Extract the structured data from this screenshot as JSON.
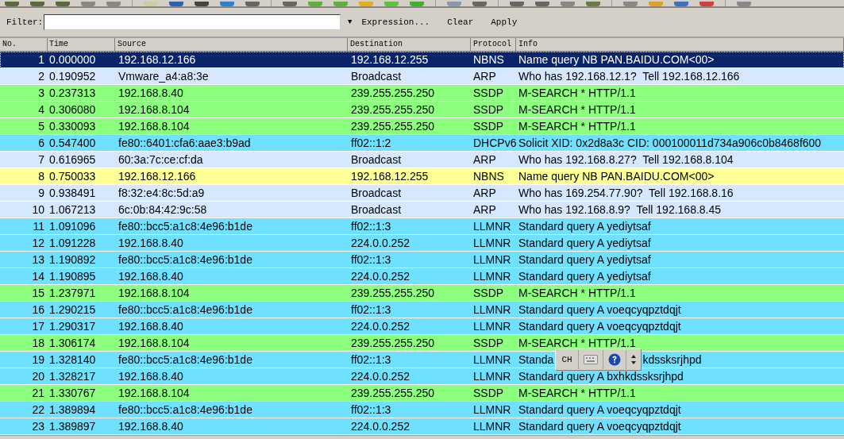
{
  "filter_bar": {
    "label": "Filter:",
    "dropdown": "▼",
    "buttons": [
      "Expression...",
      "Clear",
      "Apply"
    ]
  },
  "columns": [
    "No.",
    "Time",
    "Source",
    "Destination",
    "Protocol",
    "Info"
  ],
  "rows": [
    {
      "no": "1",
      "time": "0.000000",
      "source": "192.168.12.166",
      "destination": "192.168.12.255",
      "protocol": "NBNS",
      "info": "Name query NB PAN.BAIDU.COM<00>",
      "selected": true
    },
    {
      "no": "2",
      "time": "0.190952",
      "source": "Vmware_a4:a8:3e",
      "destination": "Broadcast",
      "protocol": "ARP",
      "info": "Who has 192.168.12.1?  Tell 192.168.12.166",
      "color": "#d6e8ff",
      "selected": false
    },
    {
      "no": "3",
      "time": "0.237313",
      "source": "192.168.8.40",
      "destination": "239.255.255.250",
      "protocol": "SSDP",
      "info": "M-SEARCH * HTTP/1.1",
      "color": "#8cff7f",
      "selected": false
    },
    {
      "no": "4",
      "time": "0.306080",
      "source": "192.168.8.104",
      "destination": "239.255.255.250",
      "protocol": "SSDP",
      "info": "M-SEARCH * HTTP/1.1",
      "color": "#8cff7f",
      "selected": false
    },
    {
      "no": "5",
      "time": "0.330093",
      "source": "192.168.8.104",
      "destination": "239.255.255.250",
      "protocol": "SSDP",
      "info": "M-SEARCH * HTTP/1.1",
      "color": "#8cff7f",
      "selected": false
    },
    {
      "no": "6",
      "time": "0.547400",
      "source": "fe80::6401:cfa6:aae3:b9ad",
      "destination": "ff02::1:2",
      "protocol": "DHCPv6",
      "info": "Solicit XID: 0x2d8a3c CID: 000100011d734a906c0b8468f600",
      "color": "#70e0ff",
      "selected": false
    },
    {
      "no": "7",
      "time": "0.616965",
      "source": "60:3a:7c:ce:cf:da",
      "destination": "Broadcast",
      "protocol": "ARP",
      "info": "Who has 192.168.8.27?  Tell 192.168.8.104",
      "color": "#d6e8ff",
      "selected": false
    },
    {
      "no": "8",
      "time": "0.750033",
      "source": "192.168.12.166",
      "destination": "192.168.12.255",
      "protocol": "NBNS",
      "info": "Name query NB PAN.BAIDU.COM<00>",
      "color": "#ffff98",
      "selected": false
    },
    {
      "no": "9",
      "time": "0.938491",
      "source": "f8:32:e4:8c:5d:a9",
      "destination": "Broadcast",
      "protocol": "ARP",
      "info": "Who has 169.254.77.90?  Tell 192.168.8.16",
      "color": "#d6e8ff",
      "selected": false
    },
    {
      "no": "10",
      "time": "1.067213",
      "source": "6c:0b:84:42:9c:58",
      "destination": "Broadcast",
      "protocol": "ARP",
      "info": "Who has 192.168.8.9?  Tell 192.168.8.45",
      "color": "#d6e8ff",
      "selected": false
    },
    {
      "no": "11",
      "time": "1.091096",
      "source": "fe80::bcc5:a1c8:4e96:b1de",
      "destination": "ff02::1:3",
      "protocol": "LLMNR",
      "info": "Standard query A yediytsaf",
      "color": "#70e0ff",
      "selected": false
    },
    {
      "no": "12",
      "time": "1.091228",
      "source": "192.168.8.40",
      "destination": "224.0.0.252",
      "protocol": "LLMNR",
      "info": "Standard query A yediytsaf",
      "color": "#70e0ff",
      "selected": false
    },
    {
      "no": "13",
      "time": "1.190892",
      "source": "fe80::bcc5:a1c8:4e96:b1de",
      "destination": "ff02::1:3",
      "protocol": "LLMNR",
      "info": "Standard query A yediytsaf",
      "color": "#70e0ff",
      "selected": false
    },
    {
      "no": "14",
      "time": "1.190895",
      "source": "192.168.8.40",
      "destination": "224.0.0.252",
      "protocol": "LLMNR",
      "info": "Standard query A yediytsaf",
      "color": "#70e0ff",
      "selected": false
    },
    {
      "no": "15",
      "time": "1.237971",
      "source": "192.168.8.104",
      "destination": "239.255.255.250",
      "protocol": "SSDP",
      "info": "M-SEARCH * HTTP/1.1",
      "color": "#8cff7f",
      "selected": false
    },
    {
      "no": "16",
      "time": "1.290215",
      "source": "fe80::bcc5:a1c8:4e96:b1de",
      "destination": "ff02::1:3",
      "protocol": "LLMNR",
      "info": "Standard query A voeqcyqpztdqjt",
      "color": "#70e0ff",
      "selected": false
    },
    {
      "no": "17",
      "time": "1.290317",
      "source": "192.168.8.40",
      "destination": "224.0.0.252",
      "protocol": "LLMNR",
      "info": "Standard query A voeqcyqpztdqjt",
      "color": "#70e0ff",
      "selected": false
    },
    {
      "no": "18",
      "time": "1.306174",
      "source": "192.168.8.104",
      "destination": "239.255.255.250",
      "protocol": "SSDP",
      "info": "M-SEARCH * HTTP/1.1",
      "color": "#8cff7f",
      "selected": false
    },
    {
      "no": "19",
      "time": "1.328140",
      "source": "fe80::bcc5:a1c8:4e96:b1de",
      "destination": "ff02::1:3",
      "protocol": "LLMNR",
      "info": "Standa",
      "info_after": "kdssksrjhpd",
      "color": "#70e0ff",
      "selected": false
    },
    {
      "no": "20",
      "time": "1.328217",
      "source": "192.168.8.40",
      "destination": "224.0.0.252",
      "protocol": "LLMNR",
      "info": "Standard query A bxhkdssksrjhpd",
      "color": "#70e0ff",
      "selected": false
    },
    {
      "no": "21",
      "time": "1.330767",
      "source": "192.168.8.104",
      "destination": "239.255.255.250",
      "protocol": "SSDP",
      "info": "M-SEARCH * HTTP/1.1",
      "color": "#8cff7f",
      "selected": false
    },
    {
      "no": "22",
      "time": "1.389894",
      "source": "fe80::bcc5:a1c8:4e96:b1de",
      "destination": "ff02::1:3",
      "protocol": "LLMNR",
      "info": "Standard query A voeqcyqpztdqjt",
      "color": "#70e0ff",
      "selected": false
    },
    {
      "no": "23",
      "time": "1.389897",
      "source": "192.168.8.40",
      "destination": "224.0.0.252",
      "protocol": "LLMNR",
      "info": "Standard query A voeqcyqpztdqjt",
      "color": "#70e0ff",
      "selected": false
    }
  ],
  "ime_bar": {
    "label": "CH"
  }
}
